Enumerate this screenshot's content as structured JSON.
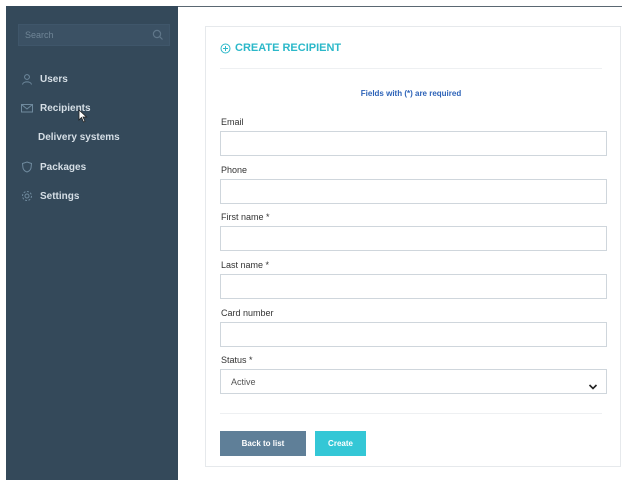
{
  "sidebar": {
    "search": {
      "placeholder": "Search",
      "icon": "search-icon"
    },
    "items": [
      {
        "label": "Users",
        "icon": "user-icon"
      },
      {
        "label": "Recipients",
        "icon": "envelope-icon"
      },
      {
        "label": "Delivery systems"
      },
      {
        "label": "Packages",
        "icon": "shield-icon"
      },
      {
        "label": "Settings",
        "icon": "gear-icon"
      }
    ]
  },
  "form": {
    "title": "CREATE RECIPIENT",
    "title_icon": "plus-circle-icon",
    "required_note": "Fields with (*) are required",
    "fields": {
      "email": {
        "label": "Email",
        "value": ""
      },
      "phone": {
        "label": "Phone",
        "value": ""
      },
      "first_name": {
        "label": "First name *",
        "value": ""
      },
      "last_name": {
        "label": "Last name *",
        "value": ""
      },
      "card_number": {
        "label": "Card number",
        "value": ""
      }
    },
    "status": {
      "label": "Status *",
      "selected": "Active"
    },
    "buttons": {
      "back": "Back to list",
      "create": "Create"
    }
  },
  "colors": {
    "sidebar_bg": "#34495a",
    "accent": "#2bb8c9",
    "note": "#2d63b8",
    "back_button": "#5f7f98",
    "create_button": "#34c7d6"
  }
}
